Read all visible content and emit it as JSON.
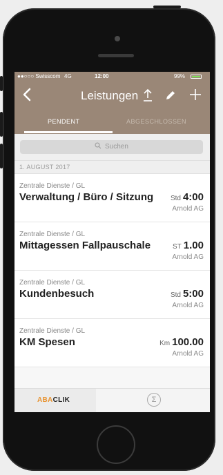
{
  "status_bar": {
    "carrier": "●●○○○ Swisscom",
    "network": "4G",
    "time": "12:00",
    "battery": "99%",
    "battery_color": "#7fe05a"
  },
  "nav": {
    "title": "Leistungen",
    "back_icon": "chevron-left-icon",
    "upload_icon": "upload-icon",
    "edit_icon": "pencil-icon",
    "add_icon": "plus-icon",
    "bar_color": "#9a8777"
  },
  "tabs": [
    {
      "label": "PENDENT",
      "active": true
    },
    {
      "label": "ABGESCHLOSSEN",
      "active": false
    }
  ],
  "search": {
    "placeholder": "Suchen",
    "icon": "search-icon"
  },
  "section": {
    "date_header": "1. AUGUST 2017"
  },
  "entries": [
    {
      "category": "Zentrale Dienste / GL",
      "title": "Verwaltung / Büro / Sitzung",
      "unit": "Std",
      "value": "4:00",
      "company": "Arnold AG"
    },
    {
      "category": "Zentrale Dienste / GL",
      "title": "Mittagessen Fallpauschale",
      "unit": "ST",
      "value": "1.00",
      "company": "Arnold AG"
    },
    {
      "category": "Zentrale Dienste / GL",
      "title": "Kundenbesuch",
      "unit": "Std",
      "value": "5:00",
      "company": "Arnold AG"
    },
    {
      "category": "Zentrale Dienste / GL",
      "title": "KM Spesen",
      "unit": "Km",
      "value": "100.00",
      "company": "Arnold AG"
    }
  ],
  "bottom_bar": {
    "brand_accent": "ABA",
    "brand_rest": "CLIK",
    "brand_color": "#e8922e",
    "sum_icon": "sigma-icon",
    "sum_glyph": "Σ"
  }
}
